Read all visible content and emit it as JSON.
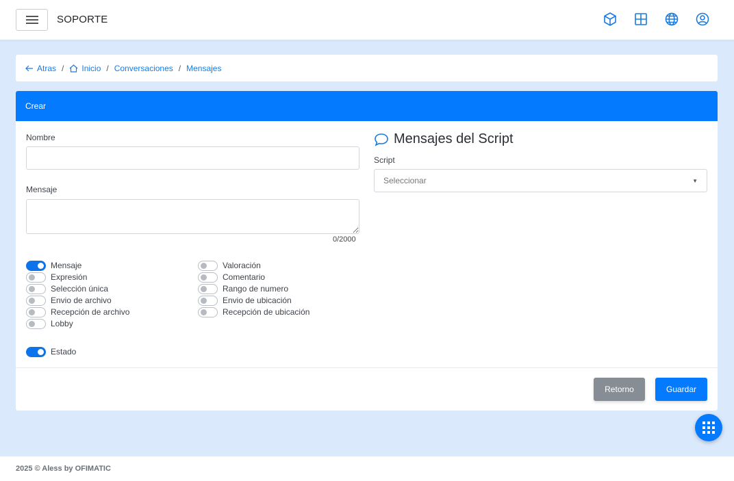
{
  "header": {
    "title": "SOPORTE",
    "icons": [
      "box-icon",
      "grid-icon",
      "globe-icon",
      "user-circle-icon"
    ]
  },
  "breadcrumb": {
    "back": "Atras",
    "home": "Inicio",
    "conversations": "Conversaciones",
    "current": "Mensajes"
  },
  "card": {
    "title": "Crear",
    "name_label": "Nombre",
    "name_value": "",
    "message_label": "Mensaje",
    "message_value": "",
    "counter": "0/2000",
    "script_section_title": "Mensajes del Script",
    "script_label": "Script",
    "script_placeholder": "Seleccionar"
  },
  "toggles_left": [
    {
      "label": "Mensaje",
      "on": true
    },
    {
      "label": "Expresión",
      "on": false
    },
    {
      "label": "Selección única",
      "on": false
    },
    {
      "label": "Envio de archivo",
      "on": false
    },
    {
      "label": "Recepción de archivo",
      "on": false
    },
    {
      "label": "Lobby",
      "on": false
    }
  ],
  "toggles_right": [
    {
      "label": "Valoración",
      "on": false
    },
    {
      "label": "Comentario",
      "on": false
    },
    {
      "label": "Rango de numero",
      "on": false
    },
    {
      "label": "Envio de ubicación",
      "on": false
    },
    {
      "label": "Recepción de ubicación",
      "on": false
    }
  ],
  "status_toggle": {
    "label": "Estado",
    "on": true
  },
  "buttons": {
    "return": "Retorno",
    "save": "Guardar"
  },
  "footer": "2025 © Aless by OFIMATIC",
  "colors": {
    "primary": "#047bff",
    "background": "#dbe9fc",
    "secondary_button": "#868d94"
  }
}
